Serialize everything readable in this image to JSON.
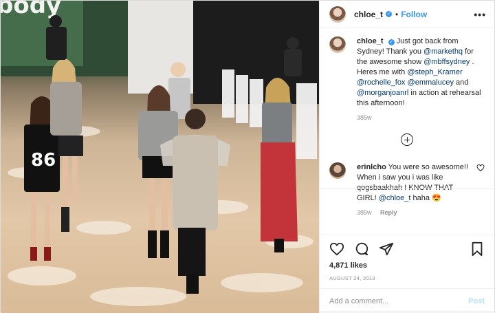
{
  "header": {
    "username": "chloe_t",
    "verified_icon": "verified-badge-icon",
    "separator": "•",
    "follow_label": "Follow",
    "more_label": "•••"
  },
  "caption": {
    "username": "chloe_t",
    "parts": [
      {
        "t": "Just got back from Sydney! Thank you ",
        "m": false
      },
      {
        "t": "@markethq",
        "m": true
      },
      {
        "t": " for the awesome show ",
        "m": false
      },
      {
        "t": "@mbffsydney",
        "m": true
      },
      {
        "t": " . Heres me with ",
        "m": false
      },
      {
        "t": "@steph_Kramer",
        "m": true
      },
      {
        "t": " ",
        "m": false
      },
      {
        "t": "@rochelle_fox",
        "m": true
      },
      {
        "t": " ",
        "m": false
      },
      {
        "t": "@emmalucey",
        "m": true
      },
      {
        "t": " and ",
        "m": false
      },
      {
        "t": "@morganjoanrl",
        "m": true
      },
      {
        "t": " in action at rehearsal this afternoon!",
        "m": false
      }
    ],
    "age": "385w"
  },
  "comments": [
    {
      "username": "erinlcho",
      "text_before": "You were so awesome!! When i saw you i was like qogsbaakhah I KNOW THAT GIRL! ",
      "mention": "@chloe_t",
      "text_after": " haha 😍",
      "age": "385w",
      "reply_label": "Reply"
    }
  ],
  "actions": {
    "likes": "4,871 likes",
    "date": "AUGUST 24, 2013"
  },
  "add_comment": {
    "placeholder": "Add a comment...",
    "post_label": "Post"
  },
  "colors": {
    "accent": "#3897f0",
    "mention": "#00376b",
    "muted": "#8e8e8e",
    "post_disabled": "#b2dffc"
  }
}
